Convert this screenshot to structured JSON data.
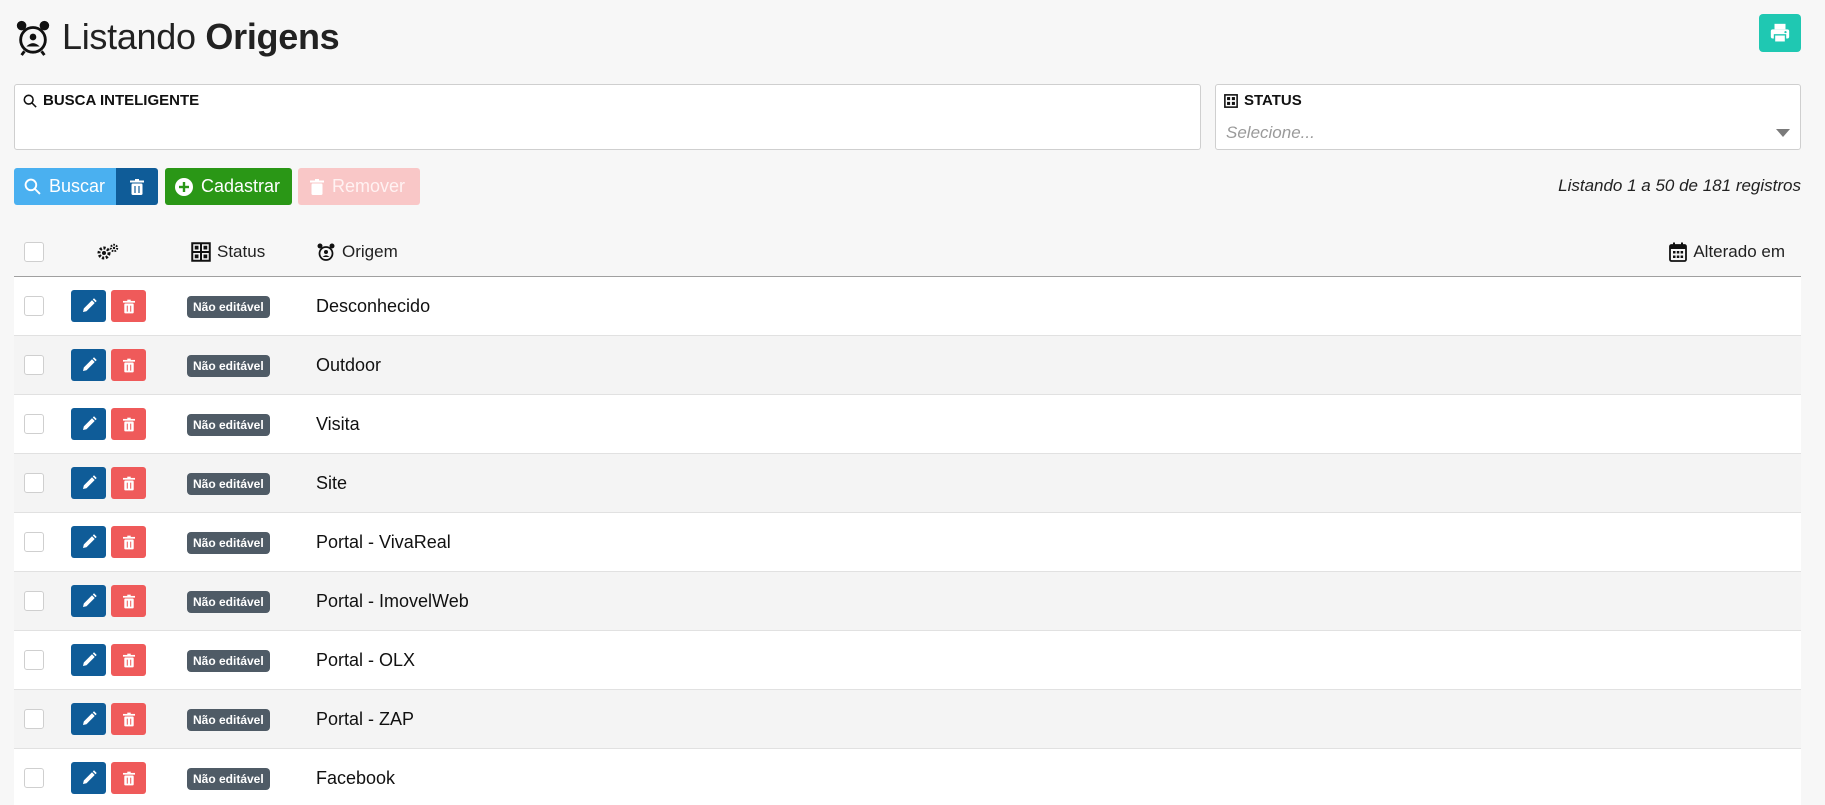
{
  "header": {
    "title_light": "Listando",
    "title_bold": "Origens",
    "print_icon": "printer-icon"
  },
  "filters": {
    "search_label": "BUSCA INTELIGENTE",
    "search_value": "",
    "status_label": "STATUS",
    "status_placeholder": "Selecione..."
  },
  "actions": {
    "buscar": "Buscar",
    "cadastrar": "Cadastrar",
    "remover": "Remover"
  },
  "records_info": "Listando 1 a 50 de 181 registros",
  "table": {
    "columns": {
      "status": "Status",
      "origem": "Origem",
      "alterado": "Alterado em"
    },
    "rows": [
      {
        "status": "Não editável",
        "origem": "Desconhecido",
        "alterado": ""
      },
      {
        "status": "Não editável",
        "origem": "Outdoor",
        "alterado": ""
      },
      {
        "status": "Não editável",
        "origem": "Visita",
        "alterado": ""
      },
      {
        "status": "Não editável",
        "origem": "Site",
        "alterado": ""
      },
      {
        "status": "Não editável",
        "origem": "Portal - VivaReal",
        "alterado": ""
      },
      {
        "status": "Não editável",
        "origem": "Portal - ImovelWeb",
        "alterado": ""
      },
      {
        "status": "Não editável",
        "origem": "Portal - OLX",
        "alterado": ""
      },
      {
        "status": "Não editável",
        "origem": "Portal - ZAP",
        "alterado": ""
      },
      {
        "status": "Não editável",
        "origem": "Facebook",
        "alterado": ""
      }
    ]
  },
  "colors": {
    "print": "#1fc8b2",
    "buscar": "#4ab0f0",
    "primary_dark": "#0f5c98",
    "cadastrar": "#2a9716",
    "remover_disabled": "#f9c7c7",
    "delete": "#ef5a5a",
    "badge": "#4f5b66"
  }
}
